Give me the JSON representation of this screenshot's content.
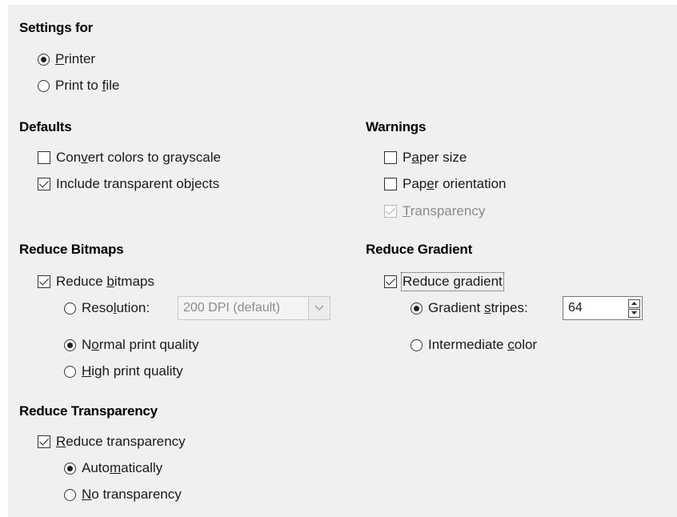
{
  "settings_for": {
    "heading": "Settings for",
    "printer": {
      "pre": "",
      "key": "P",
      "post": "rinter",
      "checked": true
    },
    "print_to_file": {
      "pre": "Print to ",
      "key": "f",
      "post": "ile",
      "checked": false
    }
  },
  "defaults": {
    "heading": "Defaults",
    "convert_grayscale": {
      "pre": "Con",
      "key": "v",
      "post": "ert colors to grayscale",
      "checked": false
    },
    "include_transparent": {
      "pre": "Include transparent objects",
      "key": "",
      "post": "",
      "checked": true
    }
  },
  "warnings": {
    "heading": "Warnings",
    "paper_size": {
      "pre": "P",
      "key": "a",
      "post": "per size",
      "checked": false
    },
    "paper_orientation": {
      "pre": "Pap",
      "key": "e",
      "post": "r orientation",
      "checked": false
    },
    "transparency": {
      "pre": "",
      "key": "T",
      "post": "ransparency",
      "checked": true,
      "disabled": true
    }
  },
  "reduce_bitmaps": {
    "heading": "Reduce Bitmaps",
    "reduce_bitmaps": {
      "pre": "Reduce ",
      "key": "b",
      "post": "itmaps",
      "checked": true
    },
    "resolution": {
      "pre": "Reso",
      "key": "l",
      "post": "ution:",
      "checked": false
    },
    "resolution_value": "200 DPI (default)",
    "normal_quality": {
      "pre": "N",
      "key": "o",
      "post": "rmal print quality",
      "checked": true
    },
    "high_quality": {
      "pre": "",
      "key": "H",
      "post": "igh print quality",
      "checked": false
    }
  },
  "reduce_gradient": {
    "heading": "Reduce Gradient",
    "reduce_gradient": {
      "pre": "Reduce ",
      "key": "g",
      "post": "radient",
      "checked": true
    },
    "gradient_stripes": {
      "pre": "Gradient ",
      "key": "s",
      "post": "tripes:",
      "checked": true
    },
    "stripes_value": "64",
    "intermediate_color": {
      "pre": "Intermediate ",
      "key": "c",
      "post": "olor",
      "checked": false
    }
  },
  "reduce_transparency": {
    "heading": "Reduce Transparency",
    "reduce_transparency": {
      "pre": "",
      "key": "R",
      "post": "educe transparency",
      "checked": true
    },
    "automatically": {
      "pre": "Auto",
      "key": "m",
      "post": "atically",
      "checked": true
    },
    "no_transparency": {
      "pre": "",
      "key": "N",
      "post": "o transparency",
      "checked": false
    }
  }
}
